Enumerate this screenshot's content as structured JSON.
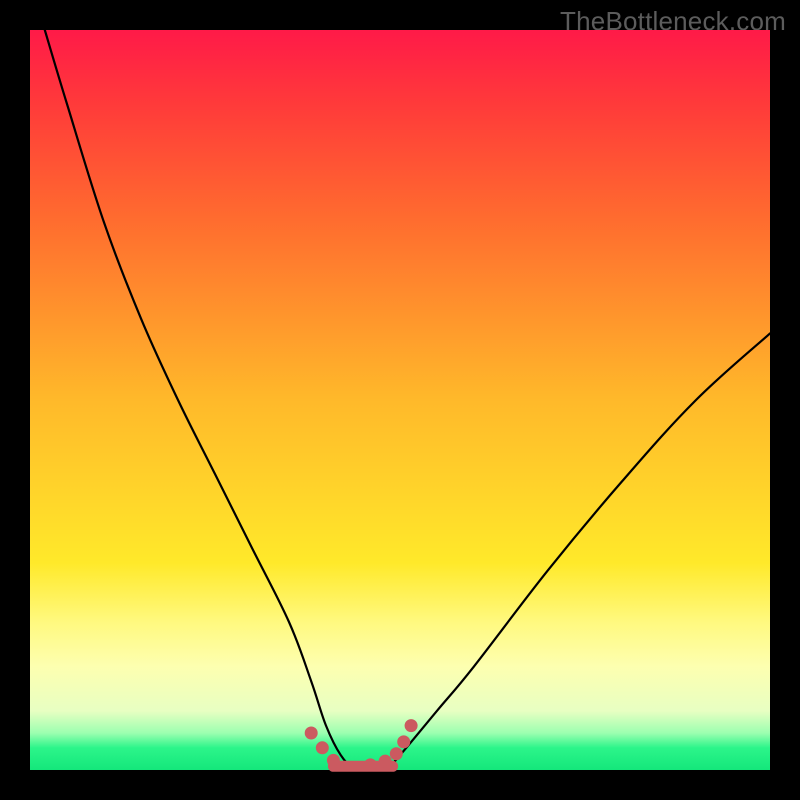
{
  "watermark": "TheBottleneck.com",
  "chart_data": {
    "type": "line",
    "title": "",
    "xlabel": "",
    "ylabel": "",
    "xlim": [
      0,
      100
    ],
    "ylim": [
      0,
      100
    ],
    "grid": false,
    "legend": false,
    "series": [
      {
        "name": "bottleneck-curve",
        "x": [
          2,
          5,
          10,
          15,
          20,
          25,
          30,
          35,
          38,
          40,
          42,
          44,
          46,
          48,
          50,
          55,
          60,
          70,
          80,
          90,
          100
        ],
        "y": [
          100,
          90,
          74,
          61,
          50,
          40,
          30,
          20,
          12,
          6,
          2,
          0,
          0,
          0,
          2,
          8,
          14,
          27,
          39,
          50,
          59
        ]
      }
    ],
    "markers": {
      "name": "valley-dots",
      "color": "#cb5a60",
      "x": [
        38,
        39.5,
        41,
        46,
        48,
        49.5,
        50.5,
        51.5
      ],
      "y": [
        5,
        3,
        1.3,
        0.7,
        1.2,
        2.2,
        3.8,
        6
      ]
    },
    "valley_band": {
      "name": "valley-band",
      "color": "#cb5a60",
      "x_range": [
        41,
        49
      ],
      "y": 0.5
    }
  }
}
